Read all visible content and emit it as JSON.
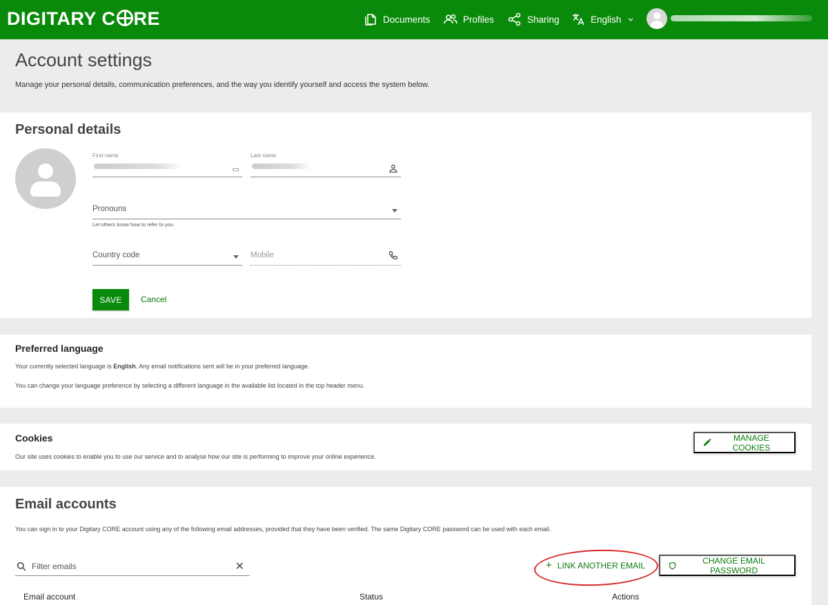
{
  "header": {
    "brand": "DIGITARY CORE",
    "brand_left": "DIGITARY C",
    "brand_right": "RE",
    "nav": [
      {
        "label": "Documents",
        "icon": "documents-icon"
      },
      {
        "label": "Profiles",
        "icon": "profiles-icon"
      },
      {
        "label": "Sharing",
        "icon": "share-icon"
      },
      {
        "label": "English",
        "icon": "translate-icon"
      }
    ]
  },
  "page": {
    "title": "Account settings",
    "subtitle": "Manage your personal details, communication preferences, and the way you identify yourself and access the system below."
  },
  "personal": {
    "title": "Personal details",
    "first_name_label": "First name",
    "last_name_label": "Last name",
    "pronouns_label": "Pronouns",
    "pronouns_helper": "Let others know how to refer to you",
    "country_code_label": "Country code",
    "mobile_placeholder": "Mobile",
    "save_label": "SAVE",
    "cancel_label": "Cancel"
  },
  "language": {
    "title": "Preferred language",
    "line1_prefix": "Your currently selected language is ",
    "line1_lang": "English",
    "line1_suffix": ". Any email notifications sent will be in your preferred language.",
    "line2": "You can change your language preference by selecting a different language in the available list located in the top header menu."
  },
  "cookies": {
    "title": "Cookies",
    "text": "Our site uses cookies to enable you to use our service and to analyse how our site is performing to improve your online experience.",
    "manage_label": "MANAGE COOKIES"
  },
  "emails": {
    "title": "Email accounts",
    "text": "You can sign in to your Digitary CORE account using any of the following email addresses, provided that they have been verified. The same Digitary CORE password can be used with each email.",
    "filter_placeholder": "Filter emails",
    "link_label": "LINK ANOTHER EMAIL",
    "change_password_label": "CHANGE EMAIL PASSWORD",
    "columns": [
      "Email account",
      "Status",
      "Actions"
    ]
  },
  "colors": {
    "brand_green": "#0a8a0a",
    "annotation_red": "#d82828"
  }
}
